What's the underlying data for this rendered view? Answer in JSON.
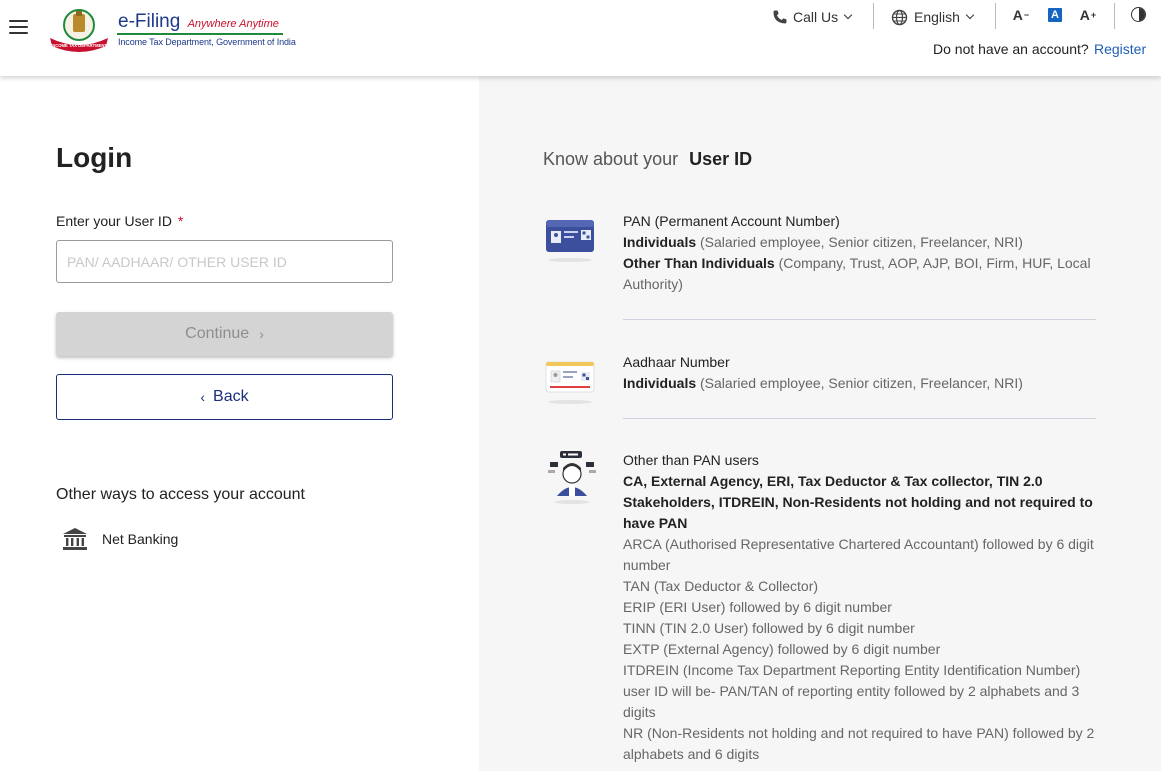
{
  "header": {
    "brand": {
      "title": "e-Filing",
      "tagline": "Anywhere Anytime",
      "subtitle": "Income Tax Department, Government of India",
      "emblem_text": "INCOME TAX DEPARTMENT"
    },
    "call_us_label": "Call Us",
    "language_label": "English",
    "font_decrease_label": "A",
    "font_normal_label": "A",
    "font_increase_label": "A",
    "account_question": "Do not have an account?",
    "register_label": "Register"
  },
  "login": {
    "title": "Login",
    "field_label": "Enter your User ID",
    "required_mark": "*",
    "input_value": "",
    "input_placeholder": "PAN/ AADHAAR/ OTHER USER ID",
    "continue_label": "Continue",
    "back_label": "Back",
    "other_ways_title": "Other ways to access your account",
    "net_banking_label": "Net Banking"
  },
  "know": {
    "prefix": "Know about your",
    "emph": "User ID",
    "pan": {
      "title": "PAN (Permanent Account Number)",
      "ind_label": "Individuals",
      "ind_text": "(Salaried employee, Senior citizen, Freelancer, NRI)",
      "other_label": "Other Than Individuals",
      "other_text": "(Company, Trust, AOP, AJP, BOI, Firm, HUF, Local Authority)"
    },
    "aadhaar": {
      "title": "Aadhaar Number",
      "ind_label": "Individuals",
      "ind_text": "(Salaried employee, Senior citizen, Freelancer, NRI)"
    },
    "other": {
      "title": "Other than PAN users",
      "bold": "CA, External Agency, ERI, Tax Deductor & Tax collector, TIN 2.0 Stakeholders, ITDREIN, Non-Residents not holding and not required to have PAN",
      "lines": [
        "ARCA (Authorised Representative Chartered Accountant) followed by 6 digit number",
        "TAN (Tax Deductor & Collector)",
        "ERIP (ERI User) followed by 6 digit number",
        "TINN (TIN 2.0 User) followed by 6 digit number",
        "EXTP (External Agency) followed by 6 digit number",
        "ITDREIN (Income Tax Department Reporting Entity Identification Number) user ID will be- PAN/TAN of reporting entity followed by 2 alphabets and 3 digits",
        "NR (Non-Residents not holding and not required to have PAN) followed by 2 alphabets and 6 digits"
      ]
    }
  },
  "colors": {
    "brand_blue": "#1d3a8a",
    "link_blue": "#1d5fb8",
    "back_border": "#1a2e7a",
    "required_red": "#c8102e",
    "panel_bg": "#f6f6f6"
  },
  "icons": [
    "menu-icon",
    "emblem-logo",
    "phone-icon",
    "globe-icon",
    "contrast-icon",
    "bank-icon",
    "pan-card-icon",
    "aadhaar-card-icon",
    "other-users-icon"
  ]
}
